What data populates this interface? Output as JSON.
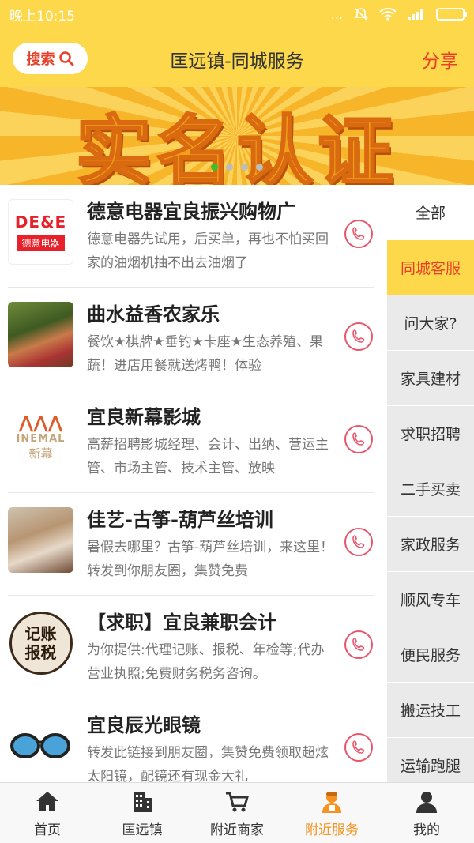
{
  "status_bar": {
    "time": "晚上10:15",
    "signal_dots": "..."
  },
  "header": {
    "search_label": "搜索",
    "title": "匡远镇-同城服务",
    "share_label": "分享"
  },
  "banner": {
    "text": "实名认证",
    "slide_count": 4,
    "active_slide": 1
  },
  "listings": [
    {
      "title": "德意电器宜良振兴购物广",
      "desc": "德意电器先试用，后买单，再也不怕买回家的油烟机抽不出去油烟了",
      "thumb": {
        "top": "DE&E",
        "bottom": "德意电器"
      }
    },
    {
      "title": "曲水益香农家乐",
      "desc": "餐饮★棋牌★垂钓★卡座★生态养殖、果蔬！进店用餐就送烤鸭！体验"
    },
    {
      "title": "宜良新幕影城",
      "desc": "高薪招聘影城经理、会计、出纳、营运主管、市场主管、技术主管、放映",
      "thumb": {
        "brand": "INEMAL",
        "sub": "新幕"
      }
    },
    {
      "title": "佳艺-古筝-葫芦丝培训",
      "desc": "暑假去哪里？古筝-葫芦丝培训，来这里！转发到你朋友圈，集赞免费"
    },
    {
      "title": "【求职】宜良兼职会计",
      "desc": "为你提供:代理记账、报税、年检等;代办营业执照;免费财务税务咨询。",
      "thumb": {
        "line1": "记账",
        "line2": "报税"
      }
    },
    {
      "title": "宜良辰光眼镜",
      "desc": "转发此链接到朋友圈，集赞免费领取超炫太阳镜，配镜还有现金大礼"
    }
  ],
  "categories": [
    "全部",
    "同城客服",
    "问大家?",
    "家具建材",
    "求职招聘",
    "二手买卖",
    "家政服务",
    "顺风专车",
    "便民服务",
    "搬运技工",
    "运输跑腿"
  ],
  "active_category": 1,
  "bottom_nav": [
    "首页",
    "匡远镇",
    "附近商家",
    "附近服务",
    "我的"
  ],
  "active_nav": 3,
  "colors": {
    "accent_yellow": "#fcd84a",
    "accent_red": "#e8402a",
    "nav_active": "#f6921e",
    "phone_pink": "#e8566b"
  },
  "icons": {
    "search": "search-icon",
    "phone": "phone-icon",
    "home": "home-icon",
    "town": "building-icon",
    "shop": "cart-icon",
    "service": "service-person-icon",
    "me": "user-icon"
  }
}
